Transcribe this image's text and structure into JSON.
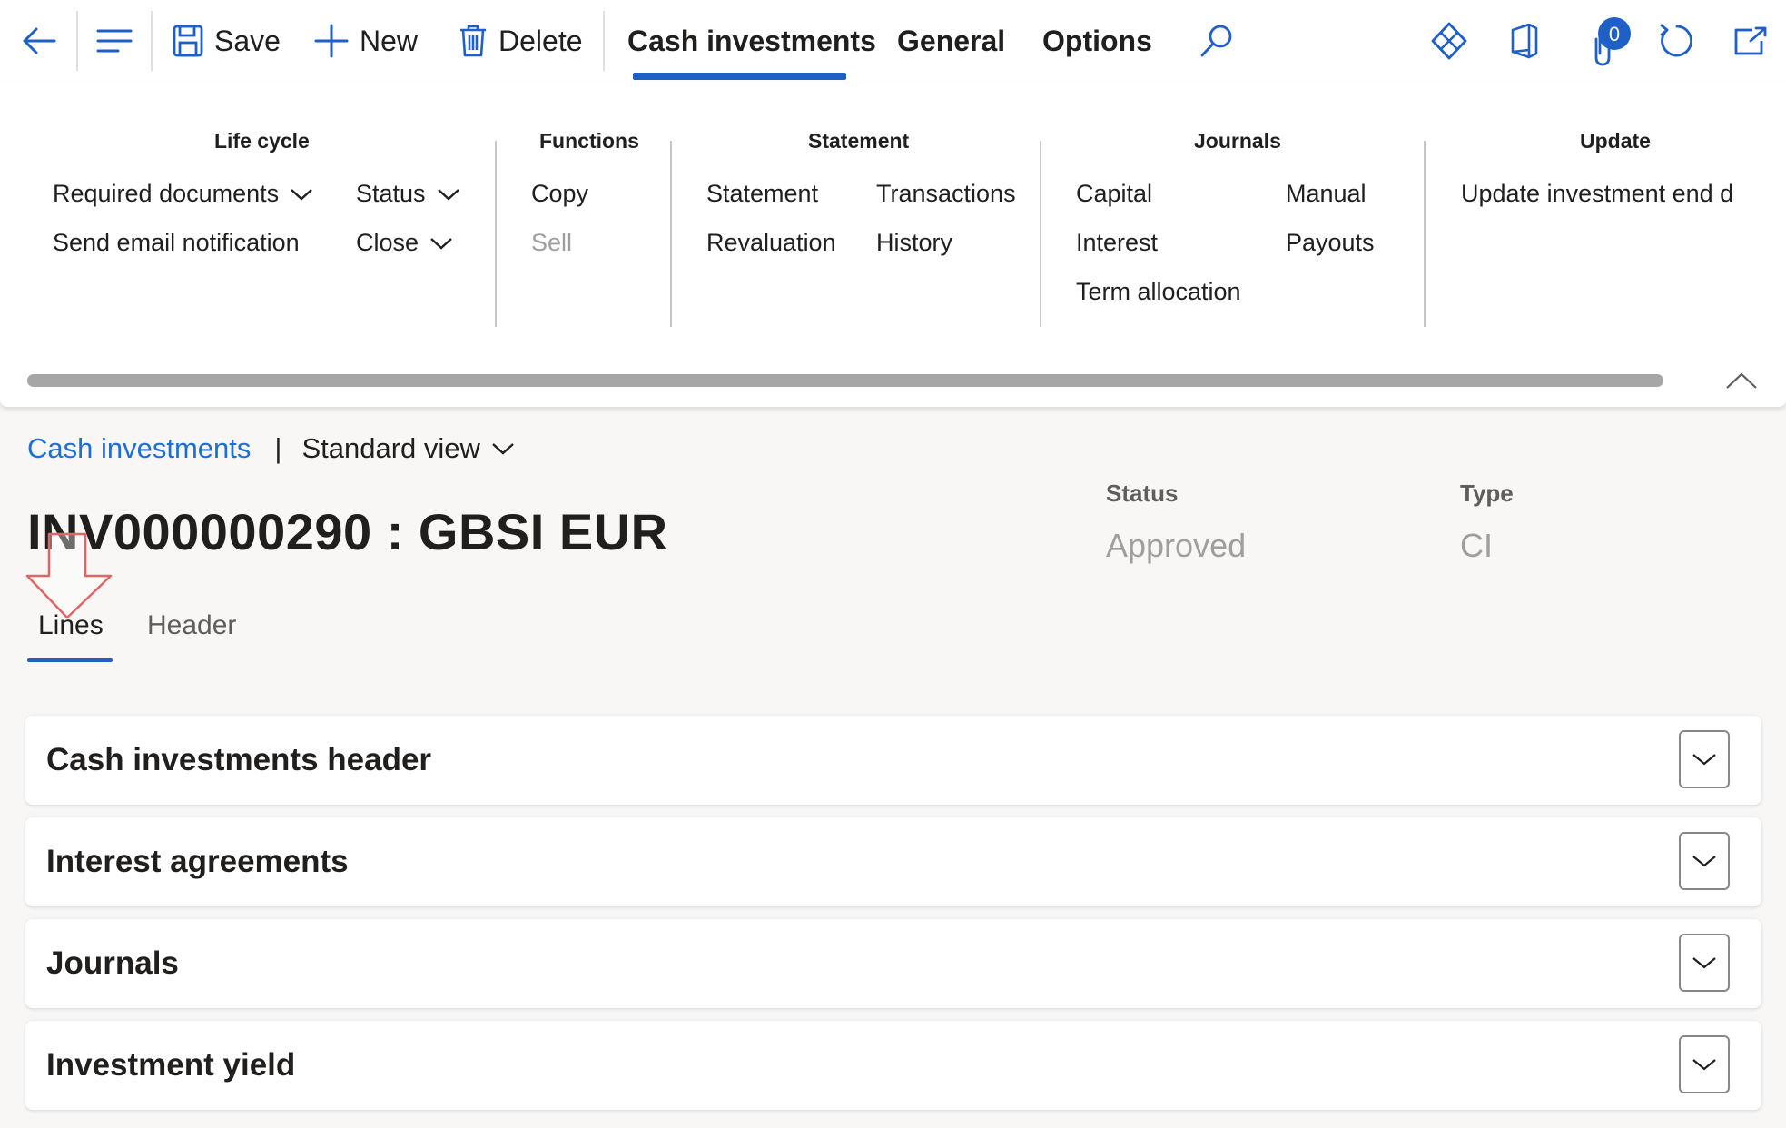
{
  "toolbar": {
    "save_label": "Save",
    "new_label": "New",
    "delete_label": "Delete",
    "tabs": [
      "Cash investments",
      "General",
      "Options"
    ],
    "active_tab": "Cash investments",
    "attachments_count": "0",
    "accent_color": "#1f5fc8"
  },
  "ribbon": {
    "groups": {
      "life_cycle": {
        "title": "Life cycle",
        "items": [
          "Required documents",
          "Send email notification",
          "Status",
          "Close"
        ]
      },
      "functions": {
        "title": "Functions",
        "items": [
          "Copy",
          "Sell"
        ]
      },
      "statement": {
        "title": "Statement",
        "items": [
          "Statement",
          "Revaluation",
          "Transactions",
          "History"
        ]
      },
      "journals": {
        "title": "Journals",
        "items": [
          "Capital",
          "Interest",
          "Term allocation",
          "Manual",
          "Payouts"
        ]
      },
      "update": {
        "title": "Update",
        "items": [
          "Update investment end d"
        ]
      }
    }
  },
  "breadcrumb": {
    "link": "Cash investments",
    "separator": "|",
    "view": "Standard view"
  },
  "record": {
    "title": "INV000000290 : GBSI EUR",
    "status_label": "Status",
    "status_value": "Approved",
    "type_label": "Type",
    "type_value": "CI"
  },
  "subtabs": [
    "Lines",
    "Header"
  ],
  "fasttabs": [
    "Cash investments header",
    "Interest agreements",
    "Journals",
    "Investment yield"
  ]
}
